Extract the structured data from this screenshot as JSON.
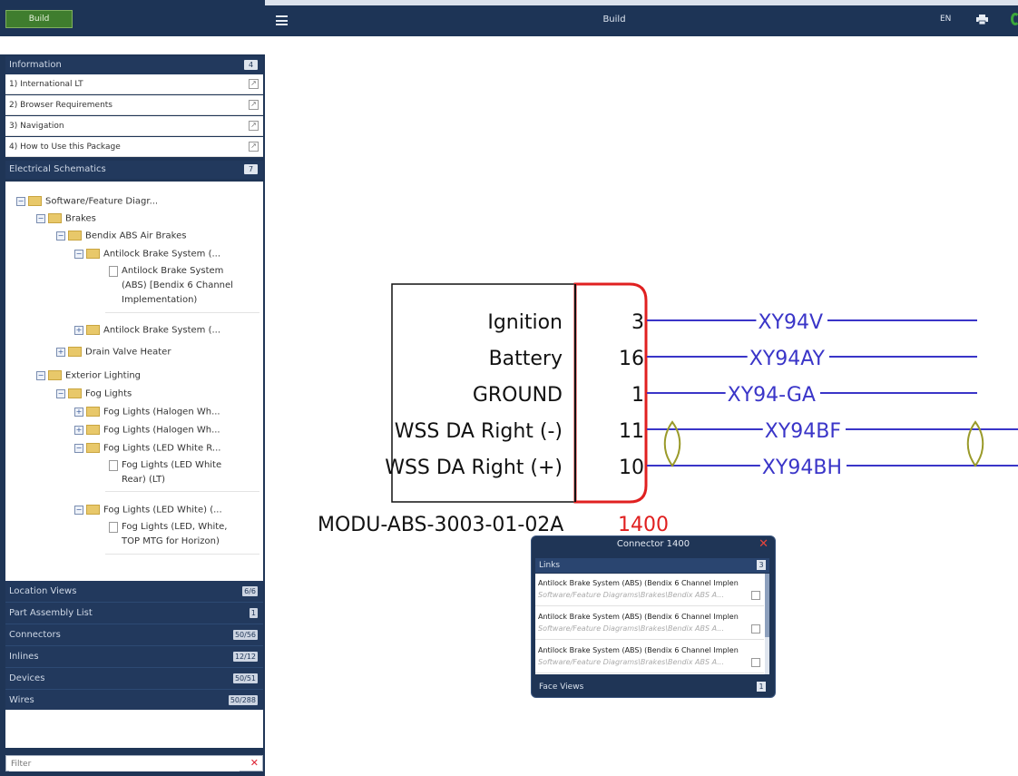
{
  "sidebar": {
    "build_label": "Build",
    "information": {
      "title": "Information",
      "badge": "4",
      "items": [
        {
          "label": "1) International LT"
        },
        {
          "label": "2) Browser Requirements"
        },
        {
          "label": "3) Navigation"
        },
        {
          "label": "4) How to Use this Package"
        }
      ]
    },
    "electrical": {
      "title": "Electrical Schematics",
      "badge": "7"
    },
    "tree": {
      "software": "Software/Feature Diagr...",
      "brakes": "Brakes",
      "bendix": "Bendix ABS Air Brakes",
      "antilock1": "Antilock Brake System (...",
      "antilock1_doc": [
        "Antilock Brake System",
        "(ABS) [Bendix 6 Channel",
        "Implementation)"
      ],
      "antilock2": "Antilock Brake System (...",
      "drain": "Drain Valve Heater",
      "exterior": "Exterior Lighting",
      "fog": "Fog Lights",
      "fog1": "Fog Lights (Halogen Wh...",
      "fog2": "Fog Lights (Halogen Wh...",
      "fog3": "Fog Lights (LED White R...",
      "fog3_doc": [
        "Fog Lights (LED White",
        "Rear) (LT)"
      ],
      "fog4": "Fog Lights (LED White) (...",
      "fog4_doc": [
        "Fog Lights (LED, White,",
        "TOP MTG for Horizon)"
      ]
    },
    "lists": [
      {
        "label": "Location Views",
        "count": "6/6"
      },
      {
        "label": "Part Assembly List",
        "count": "1"
      },
      {
        "label": "Connectors",
        "count": "50/56"
      },
      {
        "label": "Inlines",
        "count": "12/12"
      },
      {
        "label": "Devices",
        "count": "50/51"
      },
      {
        "label": "Wires",
        "count": "50/288"
      }
    ],
    "filter_placeholder": "Filter"
  },
  "topbar": {
    "title": "Build",
    "lang": "EN",
    "icons": [
      "menu-icon",
      "print-icon",
      "status-icon"
    ]
  },
  "schematic": {
    "pins": [
      {
        "label": "Ignition",
        "pin": "3",
        "wire": "XY94V"
      },
      {
        "label": "Battery",
        "pin": "16",
        "wire": "XY94AY"
      },
      {
        "label": "GROUND",
        "pin": "1",
        "wire": "XY94-GA"
      },
      {
        "label": "WSS DA Right (-)",
        "pin": "11",
        "wire": "XY94BF"
      },
      {
        "label": "WSS DA Right (+)",
        "pin": "10",
        "wire": "XY94BH"
      }
    ],
    "module_name": "MODU-ABS-3003-01-02A",
    "connector_suffix": "1400",
    "colors": {
      "wire": "#3a35c8",
      "highlight": "#e02020",
      "twist": "#9a9a2a"
    }
  },
  "popup": {
    "title": "Connector 1400",
    "links_title": "Links",
    "links_badge": "3",
    "links": [
      {
        "title": "Antilock Brake System (ABS) (Bendix 6 Channel Implen",
        "path": "Software/Feature Diagrams\\Brakes\\Bendix ABS A..."
      },
      {
        "title": "Antilock Brake System (ABS) (Bendix 6 Channel Implen",
        "path": "Software/Feature Diagrams\\Brakes\\Bendix ABS A..."
      },
      {
        "title": "Antilock Brake System (ABS) (Bendix 6 Channel Implen",
        "path": "Software/Feature Diagrams\\Brakes\\Bendix ABS A..."
      }
    ],
    "face_title": "Face Views",
    "face_badge": "1"
  }
}
